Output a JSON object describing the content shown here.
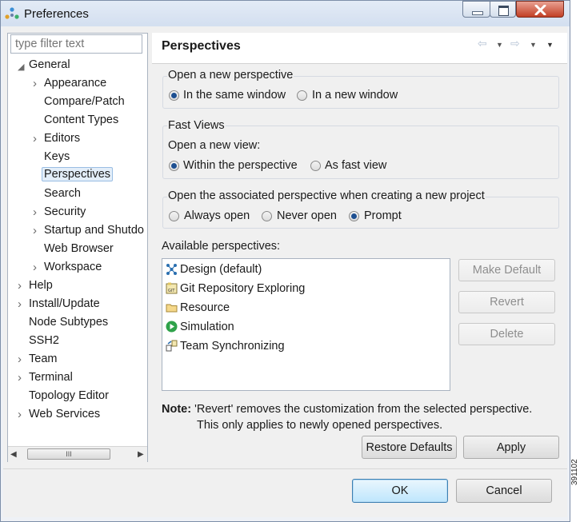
{
  "window": {
    "title": "Preferences",
    "caption_buttons": {
      "minimize": "minimize-icon",
      "maximize": "maximize-icon",
      "close": "close-icon"
    }
  },
  "filter": {
    "placeholder": "type filter text"
  },
  "tree": [
    {
      "label": "General",
      "level": 0,
      "expander": "expanded"
    },
    {
      "label": "Appearance",
      "level": 1,
      "expander": "collapsed"
    },
    {
      "label": "Compare/Patch",
      "level": 1,
      "expander": "none"
    },
    {
      "label": "Content Types",
      "level": 1,
      "expander": "none"
    },
    {
      "label": "Editors",
      "level": 1,
      "expander": "collapsed"
    },
    {
      "label": "Keys",
      "level": 1,
      "expander": "none"
    },
    {
      "label": "Perspectives",
      "level": 1,
      "expander": "none",
      "selected": true
    },
    {
      "label": "Search",
      "level": 1,
      "expander": "none"
    },
    {
      "label": "Security",
      "level": 1,
      "expander": "collapsed"
    },
    {
      "label": "Startup and Shutdo",
      "level": 1,
      "expander": "collapsed"
    },
    {
      "label": "Web Browser",
      "level": 1,
      "expander": "none"
    },
    {
      "label": "Workspace",
      "level": 1,
      "expander": "collapsed"
    },
    {
      "label": "Help",
      "level": 0,
      "expander": "collapsed"
    },
    {
      "label": "Install/Update",
      "level": 0,
      "expander": "collapsed"
    },
    {
      "label": "Node Subtypes",
      "level": 0,
      "expander": "none"
    },
    {
      "label": "SSH2",
      "level": 0,
      "expander": "none"
    },
    {
      "label": "Team",
      "level": 0,
      "expander": "collapsed"
    },
    {
      "label": "Terminal",
      "level": 0,
      "expander": "collapsed"
    },
    {
      "label": "Topology Editor",
      "level": 0,
      "expander": "none"
    },
    {
      "label": "Web Services",
      "level": 0,
      "expander": "collapsed"
    }
  ],
  "scrollbar": {
    "thumb_grip": "III"
  },
  "page": {
    "title": "Perspectives",
    "nav": {
      "back": "back-arrow-icon",
      "forward": "forward-arrow-icon",
      "menu": "view-menu-icon"
    },
    "open_perspective": {
      "label": "Open a new perspective",
      "options": [
        "In the same window",
        "In a new window"
      ],
      "selected": "In the same window"
    },
    "fast_views": {
      "label": "Fast Views",
      "sublabel": "Open a new view:",
      "options": [
        "Within the perspective",
        "As fast view"
      ],
      "selected": "Within the perspective"
    },
    "associated": {
      "label": "Open the associated perspective when creating a new project",
      "options": [
        "Always open",
        "Never open",
        "Prompt"
      ],
      "selected": "Prompt"
    },
    "available_label": "Available perspectives:",
    "perspectives": [
      {
        "label": "Design (default)",
        "icon": "design-icon"
      },
      {
        "label": "Git Repository Exploring",
        "icon": "git-icon"
      },
      {
        "label": "Resource",
        "icon": "folder-icon"
      },
      {
        "label": "Simulation",
        "icon": "simulation-play-icon"
      },
      {
        "label": "Team Synchronizing",
        "icon": "team-sync-icon"
      }
    ],
    "buttons": {
      "make_default": "Make Default",
      "revert": "Revert",
      "delete": "Delete"
    },
    "note_label": "Note:",
    "note_line1": "'Revert' removes the customization from the selected perspective.",
    "note_line2": "This only applies to newly opened perspectives.",
    "restore_defaults": "Restore Defaults",
    "apply": "Apply"
  },
  "dialog_buttons": {
    "ok": "OK",
    "cancel": "Cancel"
  },
  "side_stamp": "391102"
}
